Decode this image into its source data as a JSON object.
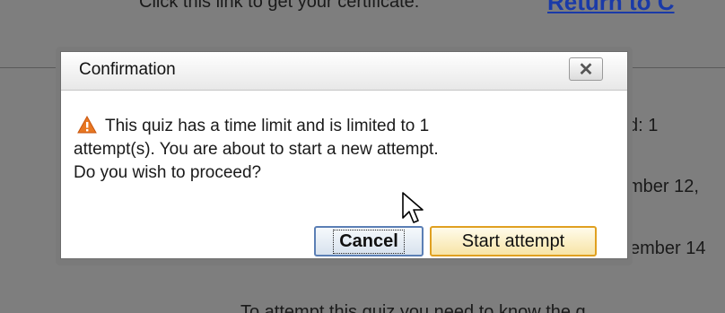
{
  "background": {
    "top_text": "Click this link to get your certificate:",
    "top_link": "Return to C",
    "line1": "d: 1",
    "line2": "mber 12,",
    "line3": "ember 14",
    "bottom_text": "To attempt this quiz you need to know the q"
  },
  "dialog": {
    "title": "Confirmation",
    "close_symbol": "✕",
    "icon": "warning-icon",
    "message_line1": "This quiz has a time limit and is limited to 1",
    "message_line2": "attempt(s). You are about to start a new attempt.",
    "message_line3": "Do you wish to proceed?",
    "cancel_label": "Cancel",
    "start_label": "Start attempt"
  },
  "colors": {
    "overlay": "#7e7e7e",
    "link": "#1a3aa8",
    "warning": "#e87722",
    "cancel_border": "#5b7fb5",
    "start_border": "#e0a020"
  }
}
